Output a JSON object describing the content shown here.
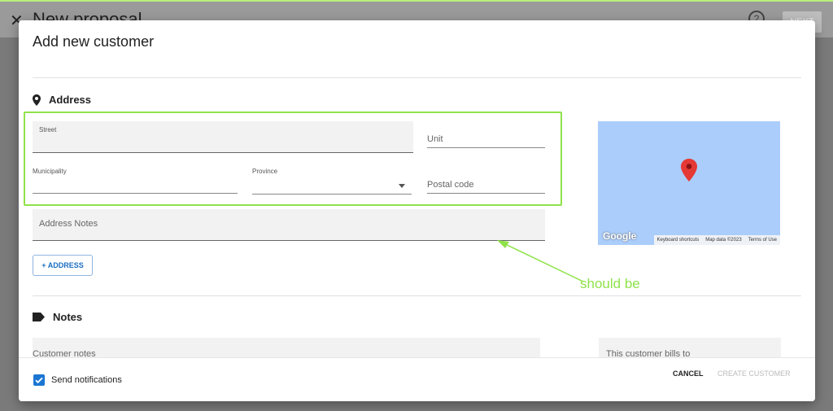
{
  "background": {
    "close_glyph": "✕",
    "title": "New proposal",
    "help_glyph": "?",
    "next_label": "NEXT"
  },
  "dialog": {
    "title": "Add new customer"
  },
  "address_section": {
    "icon": "location-pin-icon",
    "heading": "Address",
    "street_label": "Street",
    "unit_label": "Unit",
    "municipality_label": "Municipality",
    "province_label": "Province",
    "postal_code_label": "Postal code",
    "address_notes_label": "Address Notes",
    "add_address_label": "+ ADDRESS"
  },
  "map": {
    "logo": "Google",
    "attribution": [
      "Keyboard shortcuts",
      "Map data ©2023",
      "Terms of Use"
    ]
  },
  "annotation": {
    "text": "should be",
    "color": "#8fe24a"
  },
  "notes_section": {
    "icon": "label-icon",
    "heading": "Notes",
    "customer_notes_label": "Customer notes",
    "bills_to_label": "This customer bills to"
  },
  "footer": {
    "send_notifications_label": "Send notifications",
    "send_notifications_checked": true,
    "cancel_label": "CANCEL",
    "create_label": "CREATE CUSTOMER"
  },
  "colors": {
    "accent": "#1b76d2",
    "highlight": "#8fe24a",
    "map_water": "#abcdfb"
  }
}
